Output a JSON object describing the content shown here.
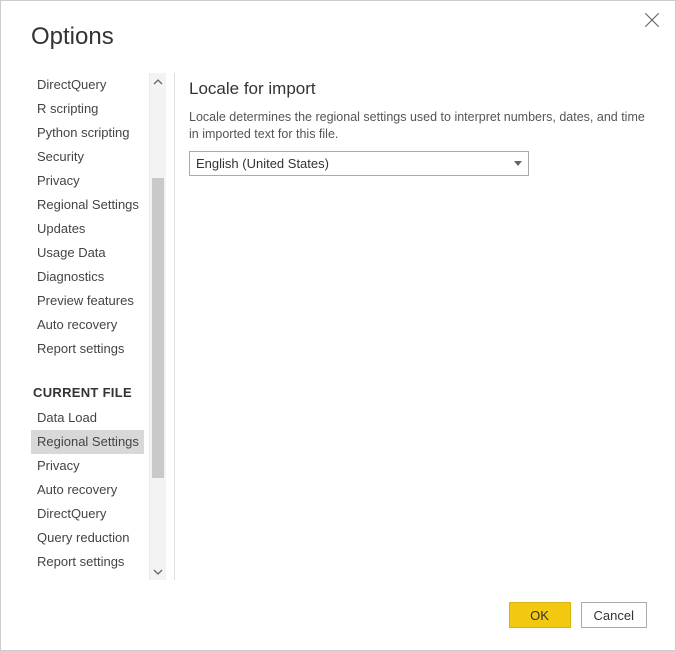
{
  "dialog": {
    "title": "Options"
  },
  "sidebar": {
    "items_top": [
      "DirectQuery",
      "R scripting",
      "Python scripting",
      "Security",
      "Privacy",
      "Regional Settings",
      "Updates",
      "Usage Data",
      "Diagnostics",
      "Preview features",
      "Auto recovery",
      "Report settings"
    ],
    "section_header": "CURRENT FILE",
    "items_bottom": [
      "Data Load",
      "Regional Settings",
      "Privacy",
      "Auto recovery",
      "DirectQuery",
      "Query reduction",
      "Report settings"
    ],
    "selected_bottom_index": 1
  },
  "content": {
    "section_title": "Locale for import",
    "section_desc": "Locale determines the regional settings used to interpret numbers, dates, and time in imported text for this file.",
    "dropdown_value": "English (United States)"
  },
  "buttons": {
    "ok": "OK",
    "cancel": "Cancel"
  }
}
